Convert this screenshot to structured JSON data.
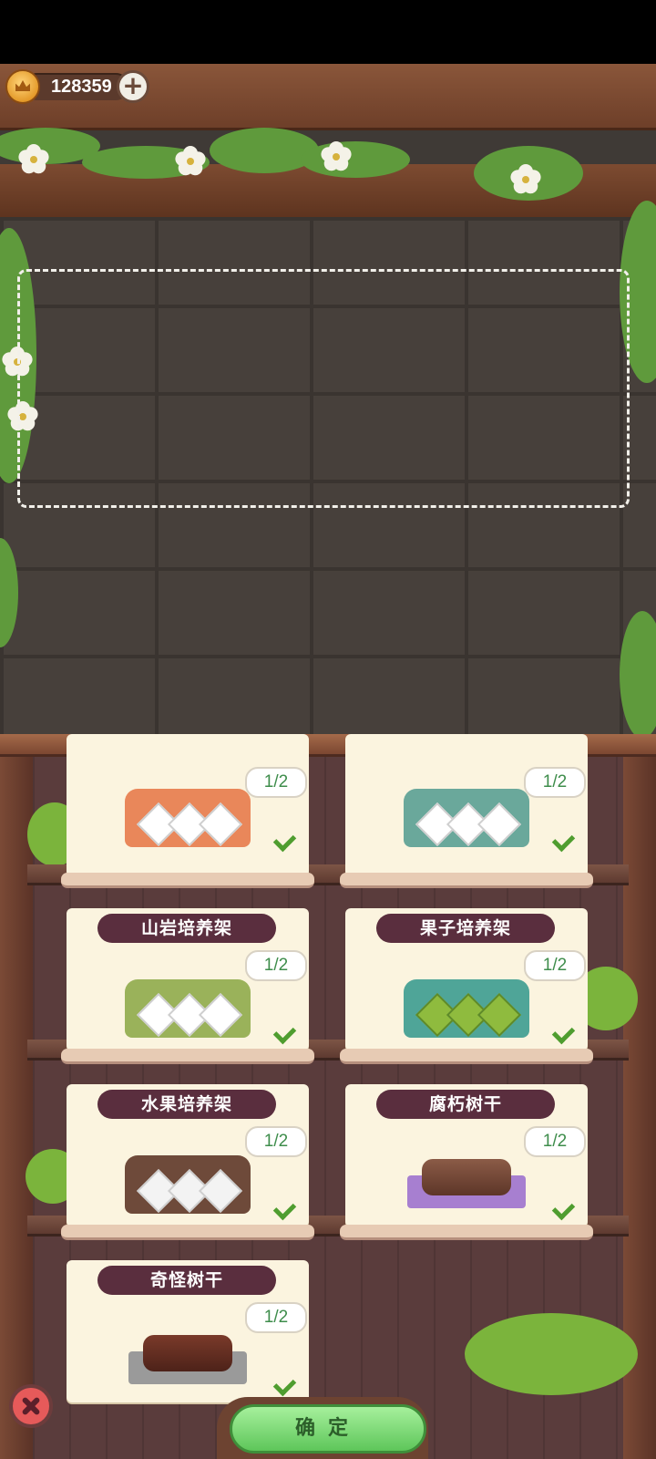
{
  "hud": {
    "coins": "128359",
    "add_icon": "plus-icon",
    "coin_icon": "crown-coin-icon"
  },
  "colors": {
    "title_bg": "#5a2e3e",
    "count_text": "#3e8d4b",
    "check": "#4f9d2f",
    "confirm": "#5ec65a",
    "close": "#e65a5a"
  },
  "items": [
    {
      "title": "",
      "count": "1/2",
      "checked": true,
      "icon": "orange-rack-icon"
    },
    {
      "title": "",
      "count": "1/2",
      "checked": true,
      "icon": "teal-rack-icon"
    },
    {
      "title": "山岩培养架",
      "count": "1/2",
      "checked": true,
      "icon": "green-rack-icon"
    },
    {
      "title": "果子培养架",
      "count": "1/2",
      "checked": true,
      "icon": "vine-rack-icon"
    },
    {
      "title": "水果培养架",
      "count": "1/2",
      "checked": true,
      "icon": "fruit-rack-icon"
    },
    {
      "title": "腐朽树干",
      "count": "1/2",
      "checked": true,
      "icon": "rotten-log-icon"
    },
    {
      "title": "奇怪树干",
      "count": "1/2",
      "checked": true,
      "icon": "strange-log-icon"
    }
  ],
  "footer": {
    "confirm_label": "确定",
    "close_icon": "close-icon"
  }
}
